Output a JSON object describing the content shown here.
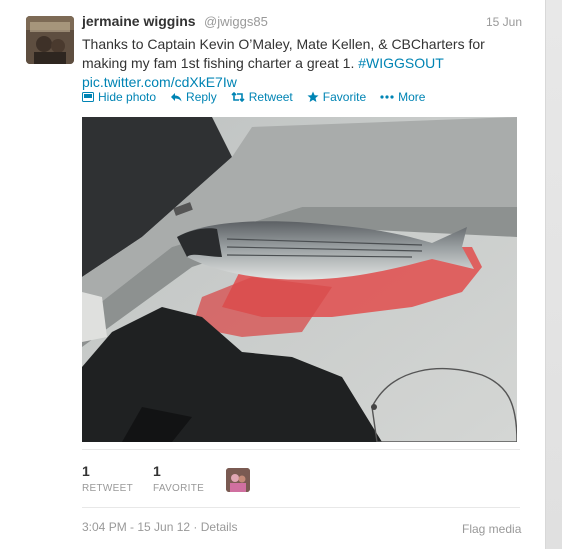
{
  "tweet": {
    "fullname": "jermaine wiggins",
    "username": "@jwiggs85",
    "date": "15 Jun",
    "text_main": "Thanks to Captain Kevin O’Maley, Mate Kellen, & CBCharters for making my fam 1st fishing charter a great 1.",
    "hashtag": "#WIGGSOUT",
    "link": "pic.twitter.com/cdXkE7Iw"
  },
  "actions": {
    "hide_photo": "Hide photo",
    "reply": "Reply",
    "retweet": "Retweet",
    "favorite": "Favorite",
    "more": "More"
  },
  "stats": {
    "retweet_count": "1",
    "retweet_label": "RETWEET",
    "favorite_count": "1",
    "favorite_label": "FAVORITE"
  },
  "footer": {
    "timestamp": "3:04 PM - 15 Jun 12",
    "separator": "·",
    "details": "Details",
    "flag_media": "Flag media"
  },
  "colors": {
    "link": "#0084b4",
    "muted": "#999999",
    "text": "#333333"
  }
}
